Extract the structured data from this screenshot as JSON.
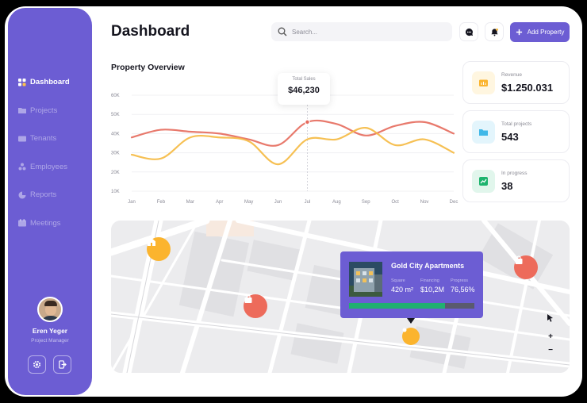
{
  "app": {
    "title": "Dashboard"
  },
  "sidebar": {
    "items": [
      {
        "label": "Dashboard",
        "icon": "grid-icon",
        "active": true
      },
      {
        "label": "Projects",
        "icon": "folder-icon",
        "active": false
      },
      {
        "label": "Tenants",
        "icon": "card-icon",
        "active": false
      },
      {
        "label": "Employees",
        "icon": "users-icon",
        "active": false
      },
      {
        "label": "Reports",
        "icon": "pie-icon",
        "active": false
      },
      {
        "label": "Meetings",
        "icon": "calendar-icon",
        "active": false
      }
    ],
    "profile": {
      "name": "Eren Yeger",
      "role": "Project Manager"
    },
    "footer_buttons": [
      {
        "icon": "gear-icon"
      },
      {
        "icon": "logout-icon"
      }
    ]
  },
  "header": {
    "search_placeholder": "Search...",
    "add_button_label": "Add Property",
    "icons": [
      "message-icon",
      "bell-icon",
      "plus-icon"
    ]
  },
  "overview": {
    "title": "Property Overview",
    "tooltip": {
      "label": "Total Sales",
      "value": "$46,230"
    }
  },
  "chart_data": {
    "type": "line",
    "categories": [
      "Jan",
      "Feb",
      "Mar",
      "Apr",
      "May",
      "Jun",
      "Jul",
      "Aug",
      "Sep",
      "Oct",
      "Nov",
      "Dec"
    ],
    "series": [
      {
        "color": "#e66a5c",
        "values": [
          38,
          42,
          41,
          40,
          37,
          34,
          46,
          45,
          39,
          44,
          46,
          40
        ]
      },
      {
        "color": "#f5b940",
        "values": [
          29,
          27,
          38,
          38,
          36,
          24,
          37,
          37,
          43,
          34,
          37,
          30
        ]
      }
    ],
    "y_ticks": [
      "10K",
      "20K",
      "30K",
      "40K",
      "50K",
      "60K"
    ],
    "ylim": [
      10,
      60
    ],
    "highlight_category": "Jul",
    "grid": true
  },
  "stats": [
    {
      "label": "Revenue",
      "value": "$1.250.031",
      "icon": "wallet-icon",
      "color": "#fbb42e",
      "bg": "#fff6e0"
    },
    {
      "label": "Total projects",
      "value": "543",
      "icon": "folder-icon",
      "color": "#41b8e8",
      "bg": "#e3f5fc"
    },
    {
      "label": "In progress",
      "value": "38",
      "icon": "trend-icon",
      "color": "#1db46e",
      "bg": "#e1f6ec"
    }
  ],
  "map": {
    "popup": {
      "title": "Gold City Apartments",
      "fields": [
        {
          "label": "Square",
          "value": "420 m²"
        },
        {
          "label": "Financing",
          "value": "$10,2M"
        },
        {
          "label": "Progress",
          "value": "76,56%"
        }
      ],
      "progress": 0.7656
    },
    "controls": {
      "zoom_in": "+",
      "zoom_out": "−"
    },
    "pins": [
      {
        "color": "#fbb42e",
        "icon": "home-icon"
      },
      {
        "color": "#ed6b5b",
        "icon": "bag-icon"
      },
      {
        "color": "#ed6b5b",
        "icon": "bag-icon"
      },
      {
        "color": "#fbb42e",
        "icon": "dot-icon"
      }
    ]
  }
}
